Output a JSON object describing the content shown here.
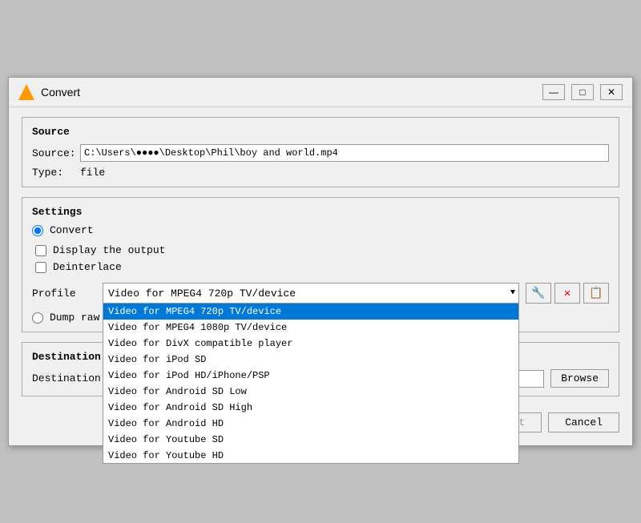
{
  "titleBar": {
    "icon": "vlc-icon",
    "title": "Convert",
    "minimize": "—",
    "maximize": "□",
    "close": "✕"
  },
  "source": {
    "sectionTitle": "Source",
    "sourceLabel": "Source:",
    "sourceValue": "C:\\Users\\●●●●\\Desktop\\Phil\\boy and world.mp4",
    "typeLabel": "Type:",
    "typeValue": "file"
  },
  "settings": {
    "sectionTitle": "Settings",
    "convertLabel": "Convert",
    "displayOutputLabel": "Display the output",
    "deinterlaceLabel": "Deinterlace",
    "profileLabel": "Profile",
    "selectedProfile": "Video for MPEG4 720p TV/device",
    "profiles": [
      "Video for MPEG4 720p TV/device",
      "Video for MPEG4 1080p TV/device",
      "Video for DivX compatible player",
      "Video for iPod SD",
      "Video for iPod HD/iPhone/PSP",
      "Video for Android SD Low",
      "Video for Android SD High",
      "Video for Android HD",
      "Video for Youtube SD",
      "Video for Youtube HD"
    ],
    "editProfileTooltip": "Edit profile",
    "deleteProfileTooltip": "Delete profile",
    "newProfileTooltip": "New profile",
    "dumpLabel": "Dump raw input"
  },
  "destination": {
    "sectionTitle": "Destination",
    "fileLabel": "Destination file:",
    "browseLabel": "Browse"
  },
  "footer": {
    "startLabel": "Start",
    "cancelLabel": "Cancel"
  }
}
